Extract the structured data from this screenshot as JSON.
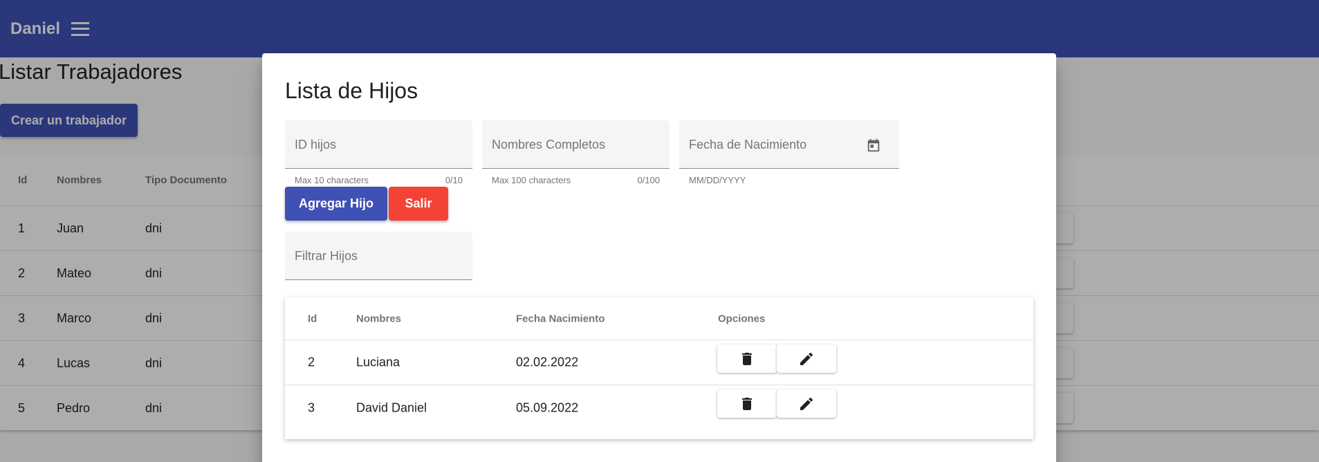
{
  "toolbar": {
    "brand": "Daniel",
    "menu_icon": "menu-icon"
  },
  "page": {
    "title": "Listar Trabajadores",
    "create_button": "Crear un trabajador",
    "table": {
      "headers": [
        "Id",
        "Nombres",
        "Tipo Documento"
      ],
      "rows": [
        [
          "1",
          "Juan",
          "dni"
        ],
        [
          "2",
          "Mateo",
          "dni"
        ],
        [
          "3",
          "Marco",
          "dni"
        ],
        [
          "4",
          "Lucas",
          "dni"
        ],
        [
          "5",
          "Pedro",
          "dni"
        ]
      ]
    }
  },
  "dialog": {
    "title": "Lista de Hijos",
    "fields": {
      "id": {
        "label": "ID hijos",
        "hint": "Max 10 characters",
        "count": "0/10"
      },
      "nombres": {
        "label": "Nombres Completos",
        "hint": "Max 100 characters",
        "count": "0/100"
      },
      "fecha": {
        "label": "Fecha de Nacimiento",
        "hint": "MM/DD/YYYY",
        "icon": "calendar-icon"
      },
      "filtro": {
        "label": "Filtrar Hijos"
      }
    },
    "buttons": {
      "add": "Agregar Hijo",
      "exit": "Salir"
    },
    "table": {
      "headers": [
        "Id",
        "Nombres",
        "Fecha Nacimiento",
        "Opciones"
      ],
      "rows": [
        [
          "2",
          "Luciana",
          "02.02.2022"
        ],
        [
          "3",
          "David Daniel",
          "05.09.2022"
        ]
      ],
      "action_icons": [
        "delete-icon",
        "edit-icon"
      ]
    }
  },
  "colors": {
    "primary": "#3f51b5",
    "warn": "#f44336",
    "toolbar": "#3f51b5"
  }
}
